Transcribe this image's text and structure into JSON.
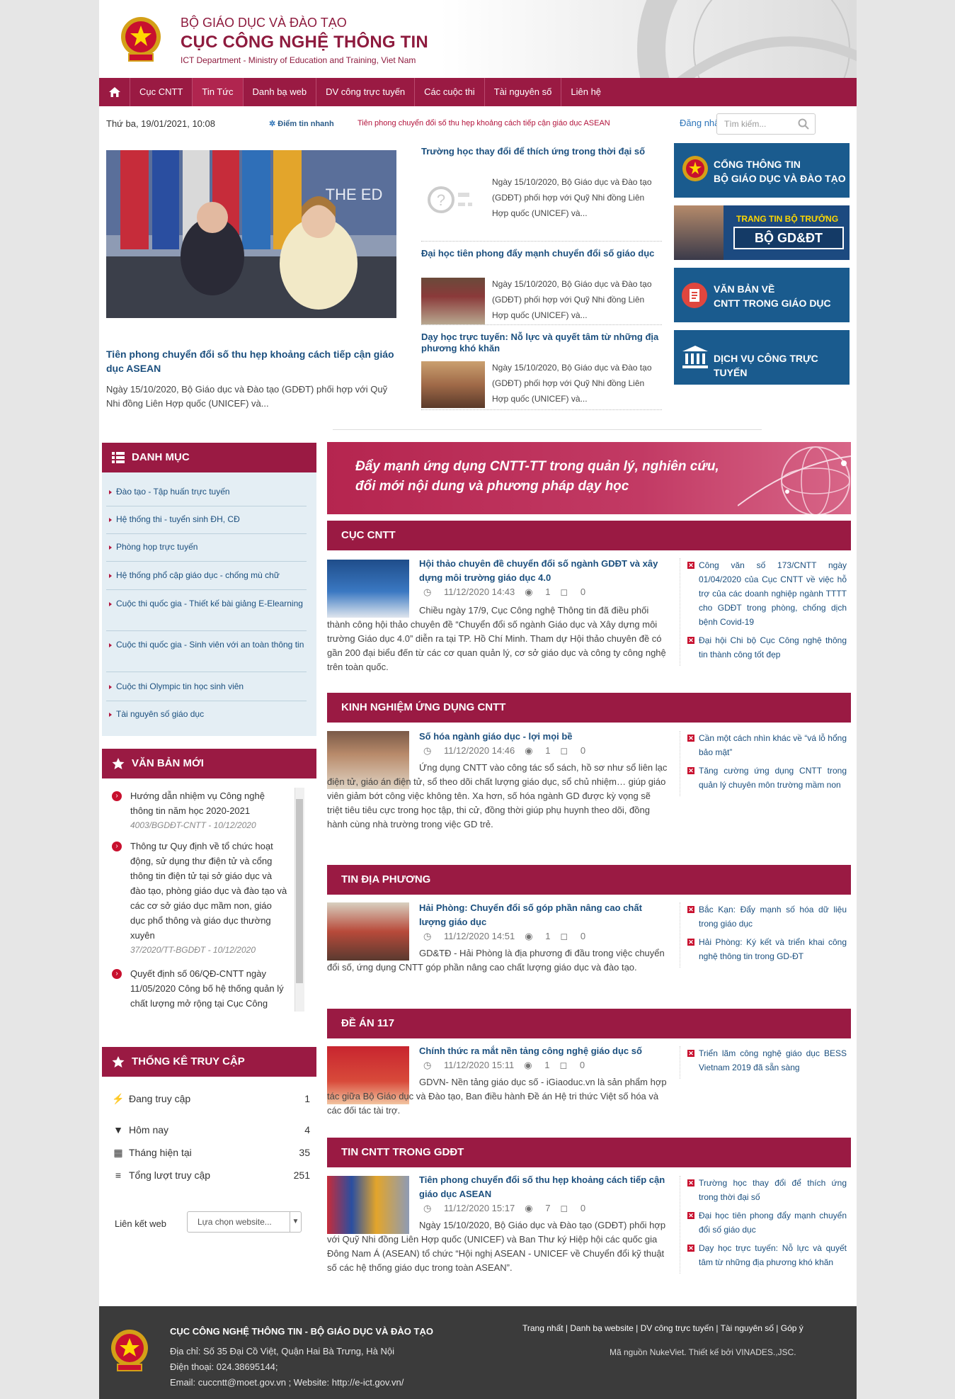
{
  "header": {
    "ministry": "BỘ GIÁO DỤC VÀ ĐÀO TẠO",
    "department": "CỤC CÔNG NGHỆ THÔNG TIN",
    "subtitle": "ICT Department - Ministry of Education and Training, Viet Nam"
  },
  "nav": {
    "items": [
      {
        "label": "Cục CNTT"
      },
      {
        "label": "Tin Tức"
      },
      {
        "label": "Danh bạ web"
      },
      {
        "label": "DV công trực tuyến"
      },
      {
        "label": "Các cuộc thi"
      },
      {
        "label": "Tài nguyên số"
      },
      {
        "label": "Liên hệ"
      }
    ],
    "active_index": 1
  },
  "infobar": {
    "date": "Thứ ba, 19/01/2021, 10:08",
    "quick_label": "Điểm tin nhanh",
    "quick_text": "Tiên phong chuyển đổi số thu hẹp khoảng cách tiếp cận giáo dục ASEAN",
    "login": "Đăng nhập",
    "search_placeholder": "Tìm kiếm..."
  },
  "featured": {
    "title": "Tiên phong chuyển đổi số thu hẹp khoảng cách tiếp cận giáo dục ASEAN",
    "desc": "Ngày 15/10/2020, Bộ Giáo dục và Đào tạo (GDĐT) phối hợp với Quỹ Nhi đồng Liên Hợp quốc (UNICEF) và...",
    "image_text": "THE ED"
  },
  "side_news": [
    {
      "title": "Trường học thay đổi để thích ứng trong thời đại số",
      "desc": "Ngày 15/10/2020, Bộ Giáo dục và Đào tạo (GDĐT) phối hợp với Quỹ Nhi đồng Liên Hợp quốc (UNICEF) và..."
    },
    {
      "title": "Đại học tiên phong đẩy mạnh chuyển đổi số giáo dục",
      "desc": "Ngày 15/10/2020, Bộ Giáo dục và Đào tạo (GDĐT) phối hợp với Quỹ Nhi đồng Liên Hợp quốc (UNICEF) và..."
    },
    {
      "title": "Dạy học trực tuyến: Nỗ lực và quyết tâm từ những địa phương khó khăn",
      "desc": "Ngày 15/10/2020, Bộ Giáo dục và Đào tạo (GDĐT) phối hợp với Quỹ Nhi đồng Liên Hợp quốc (UNICEF) và..."
    }
  ],
  "banners": [
    {
      "l1": "CỔNG THÔNG TIN",
      "l2": "BỘ GIÁO DỤC VÀ ĐÀO TẠO"
    },
    {
      "l1": "TRANG TIN BỘ TRƯỞNG",
      "l2": "BỘ GD&ĐT"
    },
    {
      "l1": "VĂN BẢN VỀ",
      "l2": "CNTT TRONG GIÁO DỤC"
    },
    {
      "l1": "DỊCH VỤ CÔNG TRỰC TUYẾN",
      "l2": ""
    }
  ],
  "categories": {
    "title": "DANH MỤC",
    "items": [
      "Đào tạo - Tập huấn trực tuyến",
      "Hệ thống thi - tuyển sinh ĐH, CĐ",
      "Phòng họp trực tuyến",
      "Hệ thống phổ cập giáo dục - chống mù chữ",
      "Cuộc thi quốc gia - Thiết kế bài giảng E-Elearning",
      "Cuộc thi quốc gia - Sinh viên với an toàn thông tin",
      "Cuộc thi Olympic tin học sinh viên",
      "Tài nguyên số giáo dục"
    ]
  },
  "new_docs": {
    "title": "VĂN BẢN MỚI",
    "items": [
      {
        "text": "Hướng dẫn nhiệm vụ Công nghệ thông tin năm học 2020-2021",
        "code": "4003/BGDĐT-CNTT - 10/12/2020"
      },
      {
        "text": "Thông tư Quy định về tổ chức hoạt động, sử dụng thư điện tử và cổng thông tin điện tử tại sở giáo dục và đào tạo, phòng giáo dục và đào tạo và các cơ sở giáo dục mầm non, giáo dục phổ thông và giáo dục thường xuyên",
        "code": "37/2020/TT-BGDĐT - 10/12/2020"
      },
      {
        "text": "Quyết định số 06/QĐ-CNTT ngày 11/05/2020 Công bố hệ thống quản lý chất lượng mở rộng tại Cục Công",
        "code": ""
      }
    ]
  },
  "stats": {
    "title": "THỐNG KÊ TRUY CẬP",
    "rows": [
      {
        "label": "Đang truy cập",
        "value": "1",
        "icon": "bolt-icon"
      },
      {
        "label": "Hôm nay",
        "value": "4",
        "icon": "filter-icon"
      },
      {
        "label": "Tháng hiện tại",
        "value": "35",
        "icon": "calendar-icon"
      },
      {
        "label": "Tổng lượt truy cập",
        "value": "251",
        "icon": "list-icon"
      }
    ],
    "link_label": "Liên kết web",
    "select_value": "Lựa chọn website..."
  },
  "main_banner": {
    "l1": "Đẩy mạnh ứng dụng CNTT-TT trong quản lý, nghiên cứu,",
    "l2": "đổi mới nội dung và phương pháp dạy học"
  },
  "sections": [
    {
      "head": "CỤC CNTT",
      "title": "Hội thảo chuyên đề chuyển đổi số ngành GDĐT và xây dựng môi trường giáo dục 4.0",
      "date": "11/12/2020 14:43",
      "views": "1",
      "comments": "0",
      "desc": "Chiều ngày 17/9, Cục Công nghệ Thông tin đã điều phối thành công hội thảo chuyên đề “Chuyển đổi số ngành Giáo dục và Xây dựng môi trường Giáo dục 4.0” diễn ra tại TP. Hồ Chí Minh. Tham dự Hội thảo chuyên đề có gần 200 đại biểu đến từ các cơ quan quản lý, cơ sở giáo dục và công ty công nghệ trên toàn quốc.",
      "related": [
        "Công văn số 173/CNTT ngày 01/04/2020 của Cục CNTT về việc hỗ trợ của các doanh nghiệp ngành TTTT cho GDĐT trong phòng, chống dịch bệnh Covid-19",
        "Đại hội Chi bộ Cục Công nghệ thông tin thành công tốt đẹp"
      ]
    },
    {
      "head": "KINH NGHIỆM ỨNG DỤNG CNTT",
      "title": "Số hóa ngành giáo dục - lợi mọi bề",
      "date": "11/12/2020 14:46",
      "views": "1",
      "comments": "0",
      "desc": "Ứng dụng CNTT vào công tác sổ sách, hồ sơ như sổ liên lạc điện tử, giáo án điện tử, sổ theo dõi chất lượng giáo dục, sổ chủ nhiệm… giúp giáo viên giảm bớt công việc không tên. Xa hơn, số hóa ngành GD được kỳ vọng sẽ triệt tiêu tiêu cực trong học tập, thi cử, đồng thời giúp phụ huynh theo dõi, đồng hành cùng nhà trường trong việc GD trẻ.",
      "related": [
        "Cần một cách nhìn khác về “vá lỗ hổng bảo mật”",
        "Tăng cường ứng dụng CNTT trong quản lý chuyên môn trường mầm non"
      ]
    },
    {
      "head": "TIN ĐỊA PHƯƠNG",
      "title": "Hải Phòng: Chuyển đổi số góp phần nâng cao chất lượng giáo dục",
      "date": "11/12/2020 14:51",
      "views": "1",
      "comments": "0",
      "desc": "GD&TĐ - Hải Phòng là địa phương đi đầu trong việc chuyển đổi số, ứng dụng CNTT góp phần nâng cao chất lượng giáo dục và đào tạo.",
      "related": [
        "Bắc Kạn: Đẩy mạnh số hóa dữ liệu trong giáo dục",
        "Hải Phòng: Ký kết và triển khai công nghệ thông tin trong GD-ĐT"
      ]
    },
    {
      "head": "ĐỀ ÁN 117",
      "title": "Chính thức ra mắt nền tảng công nghệ giáo dục số",
      "date": "11/12/2020 15:11",
      "views": "1",
      "comments": "0",
      "desc": "GDVN- Nền tảng giáo dục số - iGiaoduc.vn là sản phẩm hợp tác giữa Bộ Giáo dục và Đào tạo, Ban điều hành Đề án Hệ tri thức Việt số hóa và các đối tác tài trợ.",
      "related": [
        "Triển lãm công nghệ giáo dục BESS Vietnam 2019 đã sẵn sàng"
      ]
    },
    {
      "head": "TIN CNTT TRONG GDĐT",
      "title": "Tiên phong chuyển đổi số thu hẹp khoảng cách tiếp cận giáo dục ASEAN",
      "date": "11/12/2020 15:17",
      "views": "7",
      "comments": "0",
      "desc": "Ngày 15/10/2020, Bộ Giáo dục và Đào tạo (GDĐT) phối hợp với Quỹ Nhi đồng Liên Hợp quốc (UNICEF) và Ban Thư ký Hiệp hội các quốc gia Đông Nam Á (ASEAN) tổ chức “Hội nghị ASEAN - UNICEF về Chuyển đổi kỹ thuật số các hệ thống giáo dục trong toàn ASEAN”.",
      "related": [
        "Trường học thay đổi để thích ứng trong thời đại số",
        "Đại học tiên phong đẩy mạnh chuyển đổi số giáo dục",
        "Dạy học trực tuyến: Nỗ lực và quyết tâm từ những địa phương khó khăn"
      ]
    }
  ],
  "footer": {
    "title": "CỤC CÔNG NGHỆ THÔNG TIN - BỘ GIÁO DỤC VÀ ĐÀO TẠO",
    "address": "Địa chỉ: Số 35 Đại Cồ Việt, Quận Hai Bà Trưng, Hà Nội",
    "phone": "Điện thoại: 024.38695144;",
    "contact": "Email: cuccntt@moet.gov.vn ; Website: http://e-ict.gov.vn/",
    "links": [
      "Trang nhất",
      "Danh bạ website",
      "DV công trực tuyến",
      "Tài nguyên số",
      "Góp ý"
    ],
    "credit": "Mã nguồn NukeViet.  Thiết kế bởi VINADES.,JSC."
  },
  "colors": {
    "brand": "#9a1a43",
    "link": "#1b4f7e",
    "banner_blue": "#1a5b8e",
    "footer": "#3b3b3b"
  }
}
